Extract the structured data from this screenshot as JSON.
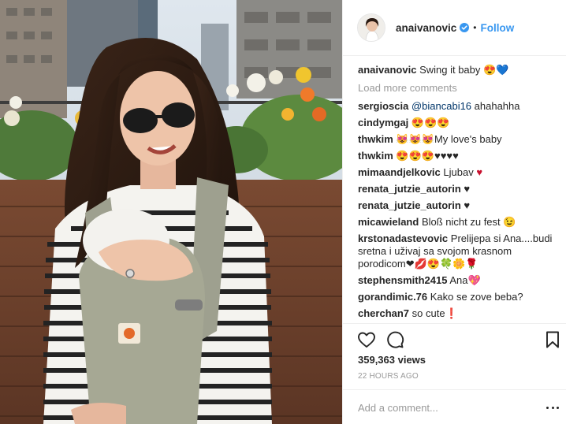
{
  "post": {
    "photo_icon": "person-with-baby-carrier-photo"
  },
  "header": {
    "username": "anaivanovic",
    "verified_icon": "verified-badge-icon",
    "separator": "•",
    "follow_label": "Follow",
    "follow_color": "#3897f0"
  },
  "caption": {
    "username": "anaivanovic",
    "text": "Swing it baby 😍💙"
  },
  "load_more_label": "Load more comments",
  "comments": [
    {
      "username": "sergioscia",
      "mention": "@biancabi16",
      "text": " ahahahha"
    },
    {
      "username": "cindymgaj",
      "text": "😍😍😍"
    },
    {
      "username": "thwkim",
      "text": "😻😻😻My love's baby"
    },
    {
      "username": "thwkim",
      "text": "😍😍😍♥♥♥♥"
    },
    {
      "username": "mimaandjelkovic",
      "text": "Ljubav",
      "heart": "♥"
    },
    {
      "username": "renata_jutzie_autorin",
      "text": "♥"
    },
    {
      "username": "renata_jutzie_autorin",
      "text": "♥"
    },
    {
      "username": "micawieland",
      "text": "Bloß nicht zu fest 😉"
    },
    {
      "username": "krstonadastevovic",
      "text": "Prelijepa si Ana....budi sretna i uživaj sa svojom krasnom porodicom❤💋😍🍀🌼🌹"
    },
    {
      "username": "stephensmith2415",
      "text": "Ana💖"
    },
    {
      "username": "gorandimic.76",
      "text": "Kako se zove beba?"
    },
    {
      "username": "cherchan7",
      "text": "so cute❗"
    }
  ],
  "actions": {
    "like_icon": "heart-outline-icon",
    "comment_icon": "comment-bubble-icon",
    "save_icon": "bookmark-icon"
  },
  "views": "359,363 views",
  "timestamp": "22 HOURS AGO",
  "add_comment": {
    "placeholder": "Add a comment...",
    "more_icon": "more-options-icon"
  },
  "colors": {
    "text": "#262626",
    "muted": "#999999",
    "link": "#3897f0",
    "mention": "#003569",
    "border": "#efefef"
  }
}
